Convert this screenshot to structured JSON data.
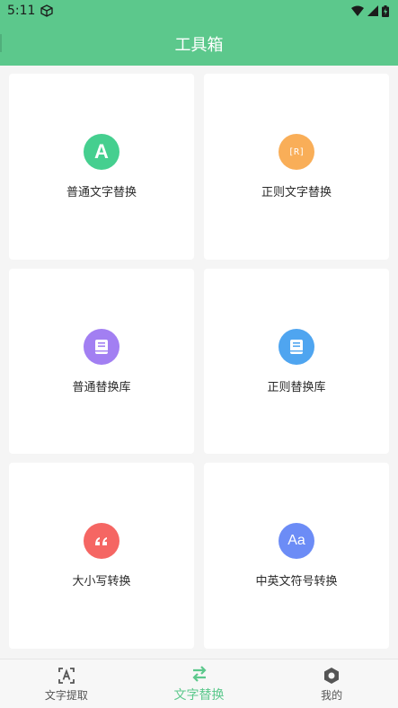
{
  "status": {
    "time": "5:11"
  },
  "appbar": {
    "title": "工具箱"
  },
  "tools": [
    {
      "label": "普通文字替换",
      "glyph": "A",
      "color": "#45cf8f"
    },
    {
      "label": "正则文字替换",
      "glyph": "[R]",
      "color": "#f9ae58"
    },
    {
      "label": "普通替换库",
      "glyph": "book",
      "color": "#a27ff2"
    },
    {
      "label": "正则替换库",
      "glyph": "book",
      "color": "#4fa5f0"
    },
    {
      "label": "大小写转换",
      "glyph": "quote",
      "color": "#f56663"
    },
    {
      "label": "中英文符号转换",
      "glyph": "Aa",
      "color": "#6c8cf6"
    }
  ],
  "nav": {
    "items": [
      {
        "label": "文字提取",
        "icon": "text-scan-icon"
      },
      {
        "label": "文字替换",
        "icon": "swap-icon"
      },
      {
        "label": "我的",
        "icon": "hexagon-icon"
      }
    ]
  },
  "colors": {
    "accent": "#5cc88c"
  }
}
